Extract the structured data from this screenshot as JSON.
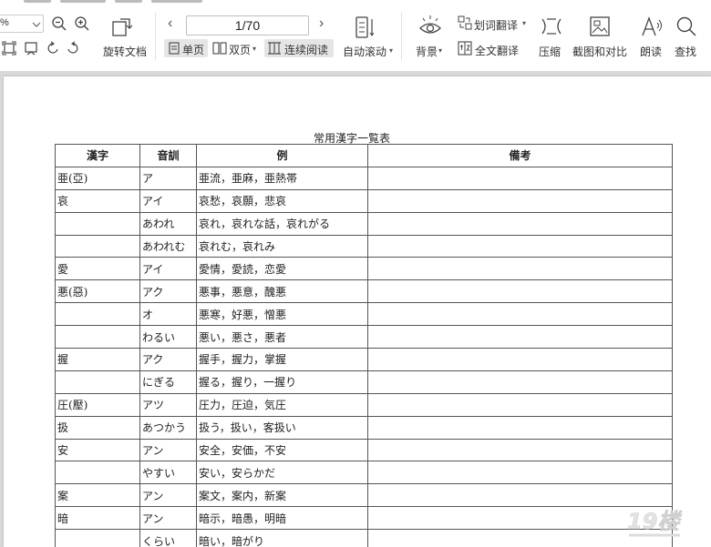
{
  "toolbar": {
    "zoom_value": "%",
    "rotate_label": "旋转文档",
    "page_indicator": "1/70",
    "single_page_label": "单页",
    "double_page_label": "双页",
    "continuous_label": "连续阅读",
    "auto_scroll_label": "自动滚动",
    "background_label": "背景",
    "word_translate_label": "划词翻译",
    "full_translate_label": "全文翻译",
    "compress_label": "压缩",
    "screenshot_compare_label": "截图和对比",
    "read_aloud_label": "朗读",
    "find_label": "查找"
  },
  "document": {
    "title": "常用漢字一覧表",
    "headers": [
      "漢字",
      "音訓",
      "例",
      "備考"
    ],
    "rows": [
      [
        "亜(亞)",
        "ア",
        "亜流，亜麻，亜熱帯",
        ""
      ],
      [
        "哀",
        "アイ",
        "哀愁，哀願，悲哀",
        ""
      ],
      [
        "",
        "あわれ",
        "哀れ，哀れな話，哀れがる",
        ""
      ],
      [
        "",
        "あわれむ",
        "哀れむ，哀れみ",
        ""
      ],
      [
        "愛",
        "アイ",
        "愛情，愛読，恋愛",
        ""
      ],
      [
        "悪(惡)",
        "アク",
        "悪事，悪意，醜悪",
        ""
      ],
      [
        "",
        "オ",
        "悪寒，好悪，憎悪",
        ""
      ],
      [
        "",
        "わるい",
        "悪い，悪さ，悪者",
        ""
      ],
      [
        "握",
        "アク",
        "握手，握力，掌握",
        ""
      ],
      [
        "",
        "にぎる",
        "握る，握り，一握り",
        ""
      ],
      [
        "圧(壓)",
        "アツ",
        "圧力，圧迫，気圧",
        ""
      ],
      [
        "扱",
        "あつかう",
        "扱う，扱い，客扱い",
        ""
      ],
      [
        "安",
        "アン",
        "安全，安価，不安",
        ""
      ],
      [
        "",
        "やすい",
        "安い，安らかだ",
        ""
      ],
      [
        "案",
        "アン",
        "案文，案内，新案",
        ""
      ],
      [
        "暗",
        "アン",
        "暗示，暗愚，明暗",
        ""
      ],
      [
        "",
        "くらい",
        "暗い，暗がり",
        ""
      ]
    ]
  },
  "colors": {
    "toolbar_bg": "#ffffff",
    "viewer_bg": "#d9d9d9",
    "active_btn": "#e5e5e5",
    "icon": "#444444"
  }
}
